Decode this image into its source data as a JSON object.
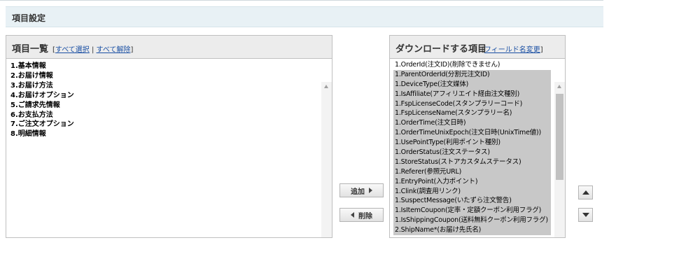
{
  "header": {
    "title": "項目設定"
  },
  "left_panel": {
    "title": "項目一覧",
    "select_all": "すべて選択",
    "deselect_all": "すべて解除",
    "items": [
      "1.基本情報",
      "2.お届け情報",
      "3.お届け方法",
      "4.お届けオプション",
      "5.ご請求先情報",
      "6.お支払方法",
      "7.ご注文オプション",
      "8.明細情報"
    ]
  },
  "right_panel": {
    "title": "ダウンロードする項目",
    "change_field_name": "フィールド名変更",
    "items": [
      "1.OrderId(注文ID)(削除できません)",
      "1.ParentOrderId(分割元注文ID)",
      "1.DeviceType(注文媒体)",
      "1.IsAffiliate(アフィリエイト経由注文種別)",
      "1.FspLicenseCode(スタンプラリーコード)",
      "1.FspLicenseName(スタンプラリー名)",
      "1.OrderTime(注文日時)",
      "1.OrderTimeUnixEpoch(注文日時(UnixTime値))",
      "1.UsePointType(利用ポイント種別)",
      "1.OrderStatus(注文ステータス)",
      "1.StoreStatus(ストアカスタムステータス)",
      "1.Referer(参照元URL)",
      "1.EntryPoint(入力ポイント)",
      "1.Clink(調査用リンク)",
      "1.SuspectMessage(いたずら注文警告)",
      "1.IsItemCoupon(定率・定額クーポン利用フラグ)",
      "1.IsShippingCoupon(送料無料クーポン利用フラグ)",
      "2.ShipName*(お届け先氏名)"
    ]
  },
  "buttons": {
    "add": "追加",
    "delete": "削除"
  },
  "colors": {
    "header_bg": "#e8f1f5",
    "link": "#1a4fa3",
    "selected_bg": "#c8c8c8"
  }
}
